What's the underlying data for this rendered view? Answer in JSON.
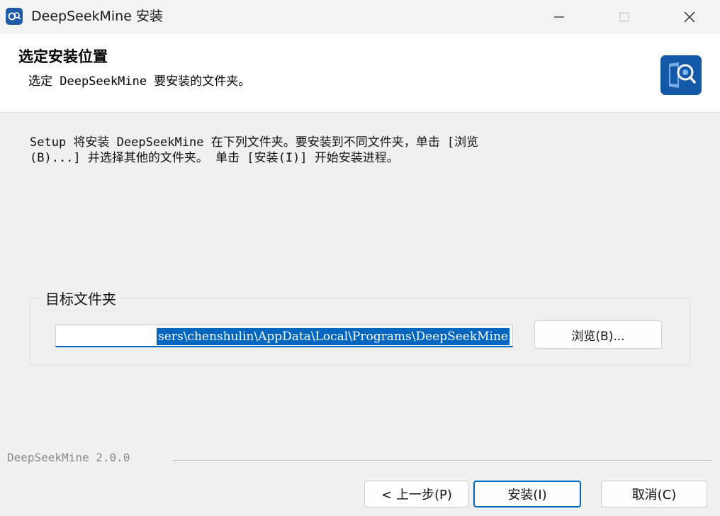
{
  "window": {
    "title": "DeepSeekMine 安装"
  },
  "header": {
    "title": "选定安装位置",
    "subtitle": "选定 DeepSeekMine 要安装的文件夹。"
  },
  "description": {
    "line1": "Setup 将安装 DeepSeekMine 在下列文件夹。要安装到不同文件夹，单击 [浏览",
    "line2": "(B)...] 并选择其他的文件夹。 单击 [安装(I)] 开始安装进程。"
  },
  "destination": {
    "group_label": "目标文件夹",
    "path_value": "sers\\chenshulin\\AppData\\Local\\Programs\\DeepSeekMine",
    "browse_label": "浏览(B)..."
  },
  "footer": {
    "version": "DeepSeekMine 2.0.0",
    "back_label": "< 上一步(P)",
    "install_label": "安装(I)",
    "cancel_label": "取消(C)"
  },
  "icons": {
    "app": "deepseekmine-app-icon",
    "header_logo": "deepseekmine-logo-icon",
    "minimize": "minimize-icon",
    "maximize": "maximize-icon",
    "close": "close-icon"
  },
  "colors": {
    "accent": "#0067c0",
    "brand": "#1458a8"
  }
}
